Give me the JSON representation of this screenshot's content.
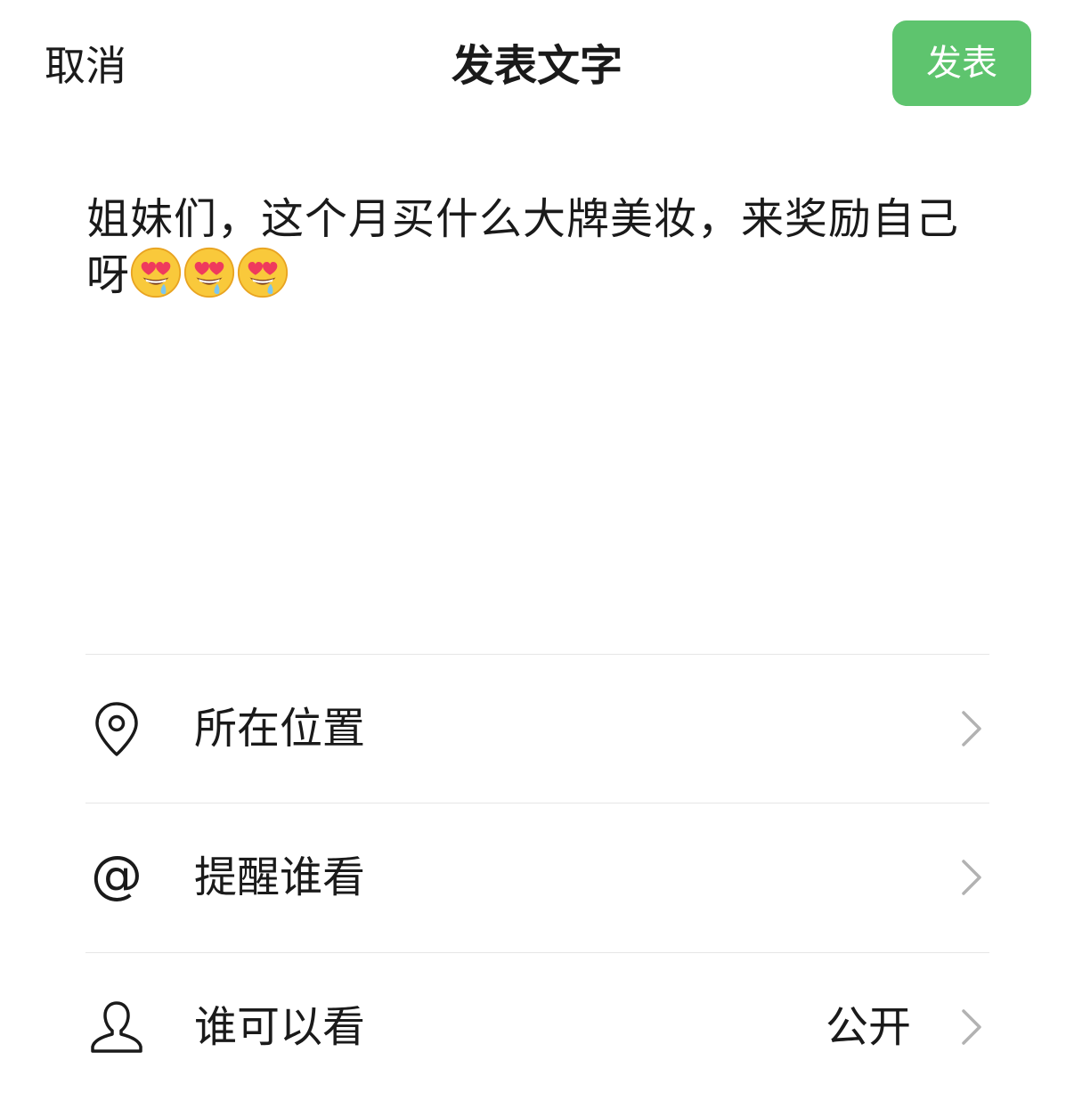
{
  "header": {
    "cancel_label": "取消",
    "title": "发表文字",
    "publish_label": "发表"
  },
  "post": {
    "text": "姐妹们，这个月买什么大牌美妆，来奖励自己呀",
    "emojis": [
      "heart-eyes-drooling-emoji",
      "heart-eyes-drooling-emoji",
      "heart-eyes-drooling-emoji"
    ]
  },
  "options": [
    {
      "label": "所在位置",
      "icon": "location-pin-icon",
      "value": ""
    },
    {
      "label": "提醒谁看",
      "icon": "at-sign-icon",
      "value": ""
    },
    {
      "label": "谁可以看",
      "icon": "person-icon",
      "value": "公开"
    }
  ],
  "colors": {
    "publish_button": "#5ec46e",
    "divider": "#e6e6e6",
    "chevron": "#b2b2b2"
  }
}
